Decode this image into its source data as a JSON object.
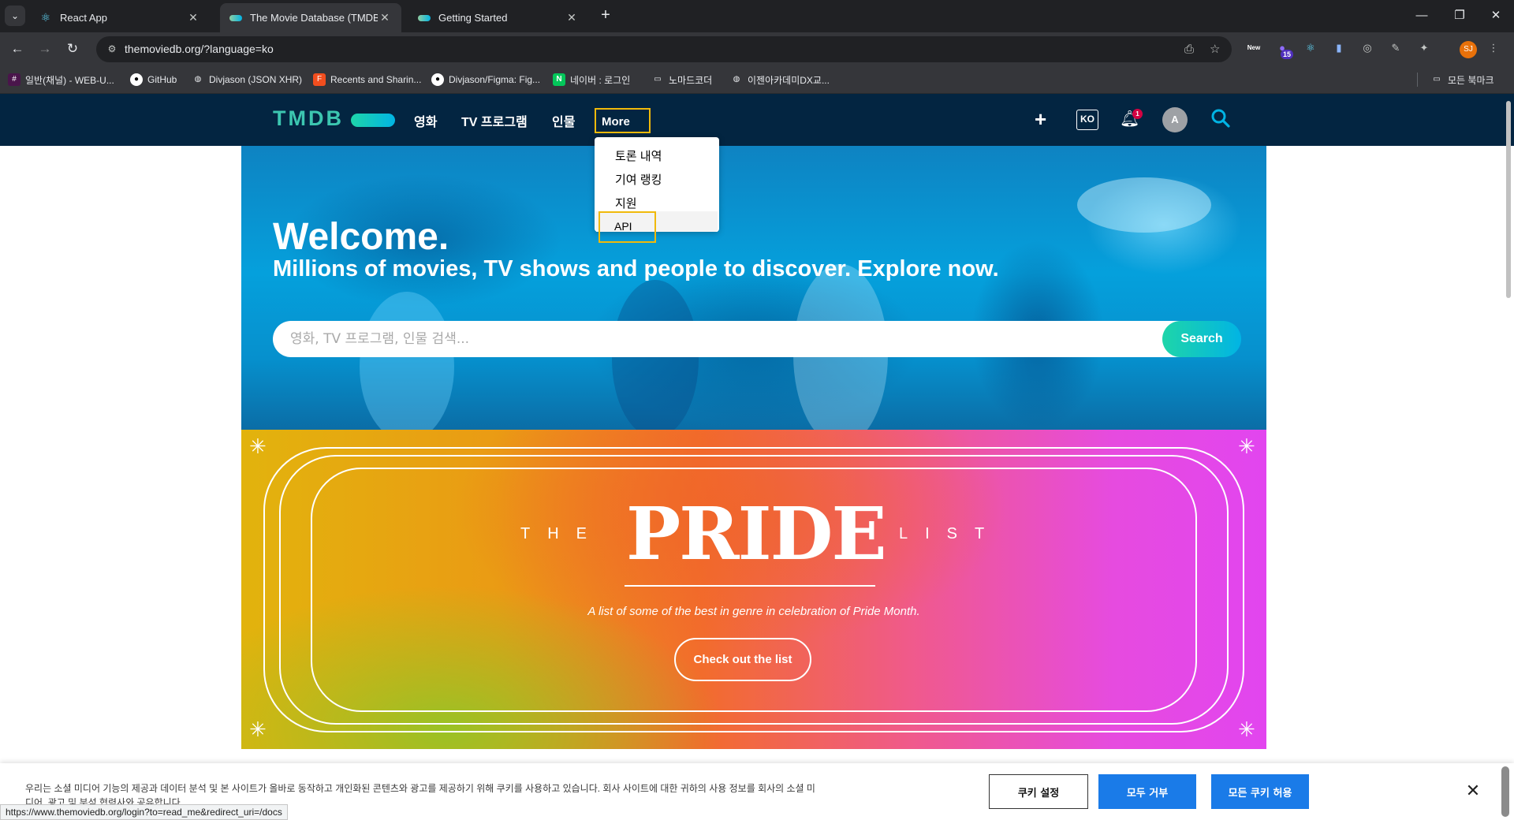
{
  "browser": {
    "tabs": [
      {
        "title": "React App",
        "icon": "react-icon"
      },
      {
        "title": "The Movie Database (TMDB)",
        "icon": "tmdb-icon",
        "active": true
      },
      {
        "title": "Getting Started",
        "icon": "tmdb-icon"
      }
    ],
    "url": "themoviedb.org/?language=ko",
    "ext_new_label": "New",
    "ext_badge": "15",
    "profile_initials": "SJ",
    "bookmarks": [
      "일반(채널) - WEB-U...",
      "GitHub",
      "Divjason (JSON XHR)",
      "Recents and Sharin...",
      "Divjason/Figma: Fig...",
      "네이버 : 로그인",
      "노마드코더",
      "이젠아카데미DX교..."
    ],
    "bookmarks_all": "모든 북마크",
    "status_url": "https://www.themoviedb.org/login?to=read_me&redirect_uri=/docs"
  },
  "header": {
    "logo": "TMDB",
    "nav": [
      "영화",
      "TV 프로그램",
      "인물",
      "More"
    ],
    "lang": "KO",
    "notification_count": "1",
    "avatar_initial": "A"
  },
  "more_menu": {
    "items": [
      "토론 내역",
      "기여 랭킹",
      "지원",
      "API"
    ]
  },
  "hero": {
    "title": "Welcome.",
    "subtitle": "Millions of movies, TV shows and people to discover. Explore now.",
    "search_placeholder": "영화, TV 프로그램, 인물 검색...",
    "search_button": "Search"
  },
  "pride": {
    "the": "THE",
    "title": "PRIDE",
    "list": "LIST",
    "subtitle": "A list of some of the best in genre in celebration of Pride Month.",
    "button": "Check out the list"
  },
  "cookie": {
    "text": "우리는 소셜 미디어 기능의 제공과 데이터 분석 및 본 사이트가 올바로 동작하고 개인화된 콘텐츠와 광고를 제공하기 위해 쿠키를 사용하고 있습니다. 회사 사이트에 대한 귀하의 사용 정보를 회사의 소셜 미디어, 광고 및 분석 협력사와 공유합니다.",
    "settings": "쿠키 설정",
    "reject_all": "모두 거부",
    "accept_all": "모든 쿠키 허용"
  },
  "colors": {
    "tmdb_navy": "#032541",
    "tmdb_teal": "#1ed5a9",
    "tmdb_blue": "#01b4e4",
    "highlight": "#f0b90b",
    "cookie_blue": "#1a7be8"
  }
}
